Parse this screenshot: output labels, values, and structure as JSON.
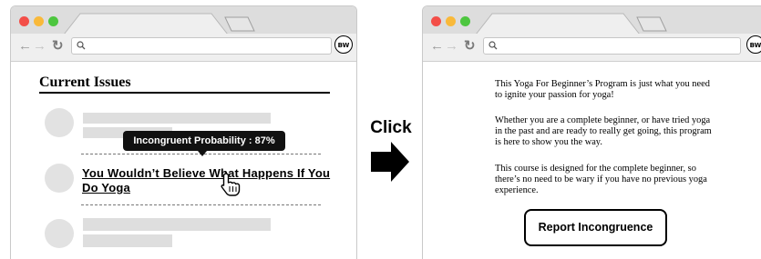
{
  "left_browser": {
    "avatar": "BW",
    "section_title": "Current Issues",
    "tooltip": "Incongruent Probability : 87%",
    "headline": "You Wouldn’t Believe What Happens If You Do Yoga",
    "icons": [
      "search-icon",
      "back-arrow-icon",
      "forward-arrow-icon",
      "reload-icon",
      "pointing-hand-cursor-icon"
    ]
  },
  "transition": {
    "label": "Click",
    "icon": "right-arrow-icon"
  },
  "right_browser": {
    "avatar": "BW",
    "paragraphs": [
      "This Yoga For Beginner’s Program is just what you need to ignite your passion for yoga!",
      "Whether you are a complete beginner, or have tried yoga in the past and are ready to really get going, this program is here to show you the way.",
      "This course is designed for the complete beginner, so there’s no need to be wary if you have no previous yoga experience."
    ],
    "report_button": "Report Incongruence"
  },
  "colors": {
    "traffic_red": "#f34e48",
    "traffic_yellow": "#f9b93a",
    "traffic_green": "#4dc63f",
    "placeholder_gray": "#dedede",
    "tooltip_bg": "#111111"
  }
}
